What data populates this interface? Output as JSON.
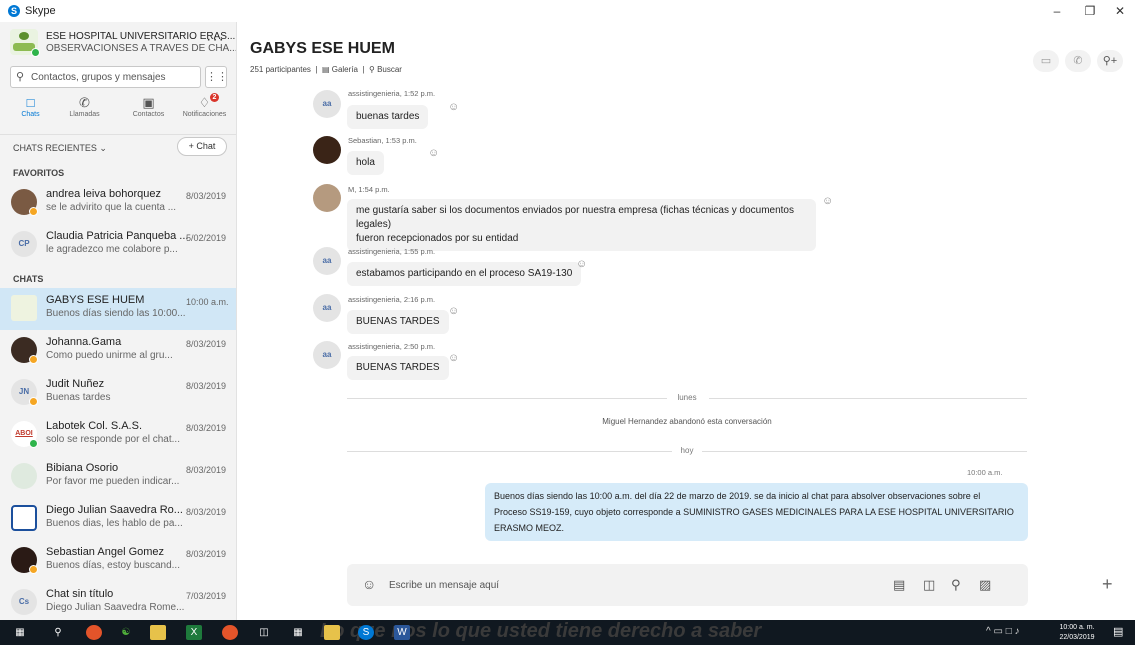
{
  "window": {
    "title": "Skype"
  },
  "profile": {
    "name": "ESE HOSPITAL UNIVERSITARIO ERAS...",
    "mood": "OBSERVACIONSES A TRAVES DE CHA..."
  },
  "search": {
    "placeholder": "Contactos, grupos y mensajes"
  },
  "nav": {
    "chats": "Chats",
    "calls": "Llamadas",
    "contacts": "Contactos",
    "notifications": "Notificaciones",
    "notif_count": "2"
  },
  "recent": {
    "label": "CHATS RECIENTES",
    "new_chat": "+ Chat"
  },
  "sections": {
    "favorites": "FAVORITOS",
    "chats": "CHATS"
  },
  "favorites": [
    {
      "name": "andrea leiva bohorquez",
      "preview": "se le advirito que la cuenta ...",
      "date": "8/03/2019",
      "initials": ""
    },
    {
      "name": "Claudia Patricia Panqueba ...",
      "preview": "le agradezco me colabore p...",
      "date": "5/02/2019",
      "initials": "CP"
    }
  ],
  "chats": [
    {
      "name": "GABYS ESE HUEM",
      "preview": "Buenos días siendo las 10:00...",
      "date": "10:00 a.m.",
      "initials": ""
    },
    {
      "name": "Johanna.Gama",
      "preview": "Como puedo unirme al gru...",
      "date": "8/03/2019",
      "initials": ""
    },
    {
      "name": "Judit Nuñez",
      "preview": "Buenas tardes",
      "date": "8/03/2019",
      "initials": "JN"
    },
    {
      "name": "Labotek Col. S.A.S.",
      "preview": "solo se responde por el chat...",
      "date": "8/03/2019",
      "initials": "ABOI"
    },
    {
      "name": "Bibiana Osorio",
      "preview": "Por favor me pueden indicar...",
      "date": "8/03/2019",
      "initials": ""
    },
    {
      "name": "Diego Julian Saavedra Ro...",
      "preview": "Buenos dias, les hablo de pa...",
      "date": "8/03/2019",
      "initials": ""
    },
    {
      "name": "Sebastian Angel Gomez",
      "preview": "Buenos días, estoy buscand...",
      "date": "8/03/2019",
      "initials": ""
    },
    {
      "name": "Chat sin título",
      "preview": "Diego Julian Saavedra Rome...",
      "date": "7/03/2019",
      "initials": "Cs"
    }
  ],
  "conversation": {
    "title": "GABYS ESE HUEM",
    "participants": "251 participantes",
    "gallery": "Galería",
    "find": "Buscar",
    "messages": [
      {
        "initials": "aa",
        "sender": "assistingenieria, 1:52 p.m.",
        "text": "buenas tardes"
      },
      {
        "initials": "",
        "sender": "Sebastian, 1:53 p.m.",
        "text": "hola"
      },
      {
        "initials": "",
        "sender": "M, 1:54 p.m.",
        "line1": "me gustaría saber si los documentos enviados por nuestra empresa (fichas técnicas y documentos legales)",
        "line2": "fueron recepcionados por su entidad"
      },
      {
        "initials": "aa",
        "sender": "assistingenieria, 1:55 p.m.",
        "text": "estabamos participando en el proceso SA19-130"
      },
      {
        "initials": "aa",
        "sender": "assistingenieria, 2:16 p.m.",
        "text": "BUENAS TARDES"
      },
      {
        "initials": "aa",
        "sender": "assistingenieria, 2:50 p.m.",
        "text": "BUENAS TARDES"
      }
    ],
    "day_monday": "lunes",
    "system_msg": "Miguel  Hernandez abandonó esta conversación",
    "day_today": "hoy",
    "outgoing_time": "10:00 a.m.",
    "outgoing": {
      "line1": "Buenos días siendo las 10:00 a.m. del día 22 de marzo de 2019. se da inicio al chat para absolver observaciones sobre el",
      "line2": "Proceso SS19-159, cuyo objeto corresponde a SUMINISTRO GASES MEDICINALES PARA LA ESE HOSPITAL UNIVERSITARIO",
      "line3": "ERASMO MEOZ."
    },
    "composer_placeholder": "Escribe un mensaje aquí"
  },
  "taskbar": {
    "banner": "Lo que nos lo que usted tiene derecho a saber",
    "time": "10:00 a. m.",
    "date": "22/03/2019"
  },
  "colors": {
    "accent": "#0078d4",
    "selected": "#d1e7f6",
    "outgoing_bubble": "#d6ebf9",
    "badge": "#d9352b",
    "online": "#2fb44b",
    "away": "#f5a623"
  }
}
